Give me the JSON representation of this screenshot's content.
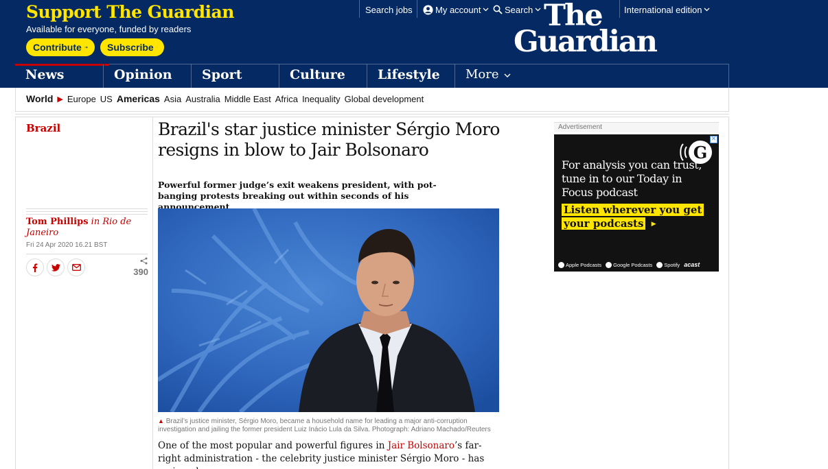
{
  "header": {
    "support_title": "Support The Guardian",
    "support_sub": "Available for everyone, funded by readers",
    "contribute_label": "Contribute",
    "subscribe_label": "Subscribe",
    "search_jobs": "Search jobs",
    "my_account": "My account",
    "search": "Search",
    "edition": "International edition",
    "logo_line1": "The",
    "logo_line2": "Guardian",
    "brand_color": "#052962",
    "accent_color": "#ffe500"
  },
  "nav": {
    "items": [
      {
        "label": "News",
        "color": "#c70000"
      },
      {
        "label": "Opinion",
        "color": "#e05e00"
      },
      {
        "label": "Sport",
        "color": "#0084c6"
      },
      {
        "label": "Culture",
        "color": "#a1845c"
      },
      {
        "label": "Lifestyle",
        "color": "#bb3b80"
      }
    ],
    "more": "More"
  },
  "subnav": {
    "items": [
      "World",
      "Europe",
      "US",
      "Americas",
      "Asia",
      "Australia",
      "Middle East",
      "Africa",
      "Inequality",
      "Global development"
    ]
  },
  "article": {
    "section": "Brazil",
    "headline": "Brazil's star justice minister Sérgio Moro resigns in blow to Jair Bolsonaro",
    "standfirst": "Powerful former judge’s exit weakens president, with pot-banging protests breaking out within seconds of his announcement",
    "author": "Tom Phillips",
    "location": "in Rio de Janeiro",
    "date": "Fri 24 Apr 2020 16.21 BST",
    "share_count": "390",
    "caption": "Brazil’s justice minister, Sérgio Moro, became a household name for leading a major anti-corruption investigation and jailing the former president Luiz Inácio Lula da Silva. Photograph: Adriano Machado/Reuters",
    "body_pre": "One of the most popular and powerful figures in ",
    "body_link": "Jair Bolsonaro",
    "body_post": "’s far-right administration - the celebrity justice minister Sérgio Moro - has resigned,"
  },
  "ad": {
    "label": "Advertisement",
    "text": "For analysis you can trust, tune in to our Today in Focus podcast",
    "cta": "Listen wherever you get your podcasts",
    "platforms": [
      "Apple Podcasts",
      "Google Podcasts",
      "Spotify",
      "acast"
    ]
  }
}
